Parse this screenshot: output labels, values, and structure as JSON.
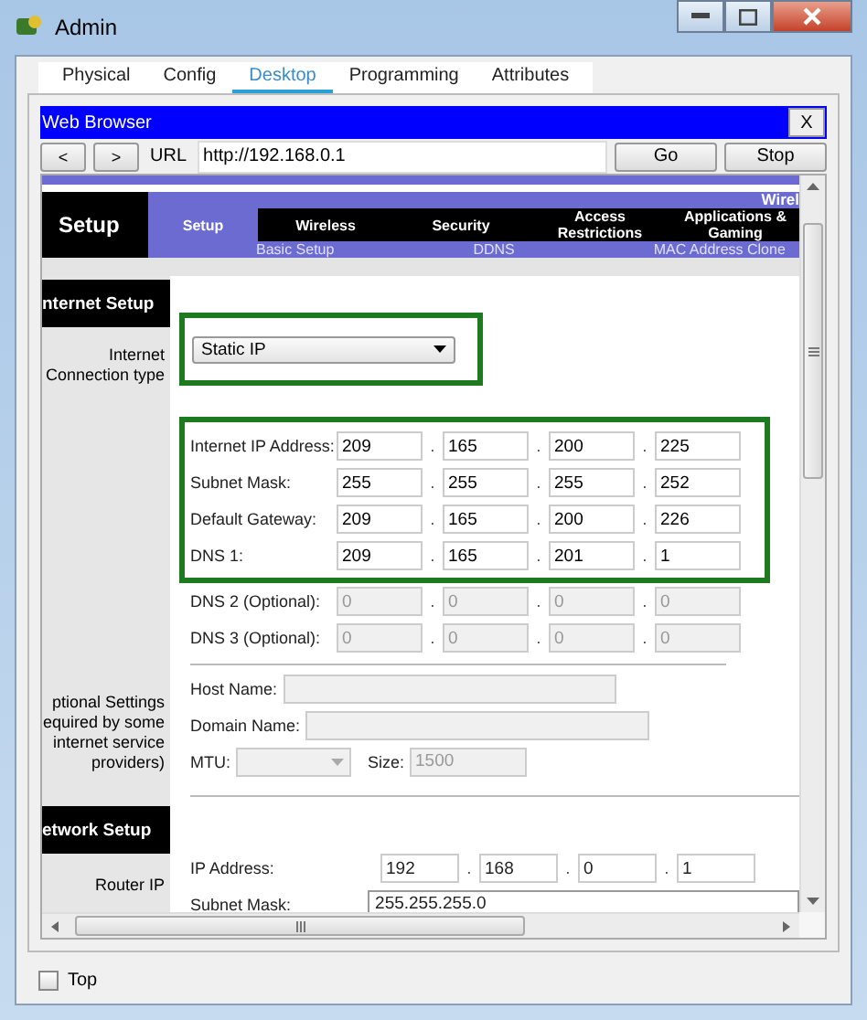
{
  "window": {
    "title": "Admin"
  },
  "tabs": [
    {
      "label": "Physical",
      "selected": false
    },
    {
      "label": "Config",
      "selected": false
    },
    {
      "label": "Desktop",
      "selected": true
    },
    {
      "label": "Programming",
      "selected": false
    },
    {
      "label": "Attributes",
      "selected": false
    }
  ],
  "browser": {
    "title": "Web Browser",
    "close": "X",
    "back": "<",
    "forward": ">",
    "url_label": "URL",
    "url": "http://192.168.0.1",
    "go": "Go",
    "stop": "Stop"
  },
  "router_page": {
    "octet_separator": ".",
    "header": {
      "title": "Setup",
      "corner_text": "Wirel",
      "tabs": [
        {
          "label": "Setup",
          "selected": true
        },
        {
          "label": "Wireless",
          "selected": false
        },
        {
          "label": "Security",
          "selected": false
        },
        {
          "label": "Access Restrictions",
          "selected": false
        },
        {
          "label": "Applications & Gaming",
          "selected": false
        }
      ],
      "subtabs": [
        "Basic Setup",
        "DDNS",
        "MAC Address Clone"
      ]
    },
    "internet_setup": {
      "heading": "nternet Setup",
      "connection_label": "Internet\nConnection type",
      "connection_type": {
        "value": "Static IP",
        "highlighted": true
      },
      "static_ip": {
        "highlighted": true,
        "rows": [
          {
            "label": "Internet IP Address:",
            "octets": [
              "209",
              "165",
              "200",
              "225"
            ],
            "disabled": false
          },
          {
            "label": "Subnet Mask:",
            "octets": [
              "255",
              "255",
              "255",
              "252"
            ],
            "disabled": false
          },
          {
            "label": "Default Gateway:",
            "octets": [
              "209",
              "165",
              "200",
              "226"
            ],
            "disabled": false
          },
          {
            "label": "DNS 1:",
            "octets": [
              "209",
              "165",
              "201",
              "1"
            ],
            "disabled": false
          }
        ]
      },
      "optional_dns": [
        {
          "label": "DNS 2 (Optional):",
          "octets": [
            "0",
            "0",
            "0",
            "0"
          ],
          "disabled": true
        },
        {
          "label": "DNS 3 (Optional):",
          "octets": [
            "0",
            "0",
            "0",
            "0"
          ],
          "disabled": true
        }
      ]
    },
    "optional_settings": {
      "label": "ptional Settings\nequired by some\ninternet service\nproviders)",
      "host_name_label": "Host Name:",
      "domain_name_label": "Domain Name:",
      "mtu_label": "MTU:",
      "size_label": "Size:",
      "size_value": "1500"
    },
    "network_setup": {
      "heading": "etwork Setup",
      "router_ip_label": "Router IP",
      "ip_label": "IP Address:",
      "octets": [
        "192",
        "168",
        "0",
        "1"
      ],
      "subnet_label": "Subnet Mask:",
      "subnet_value": "255.255.255.0"
    }
  },
  "top_checkbox": {
    "label": "Top",
    "checked": false
  }
}
